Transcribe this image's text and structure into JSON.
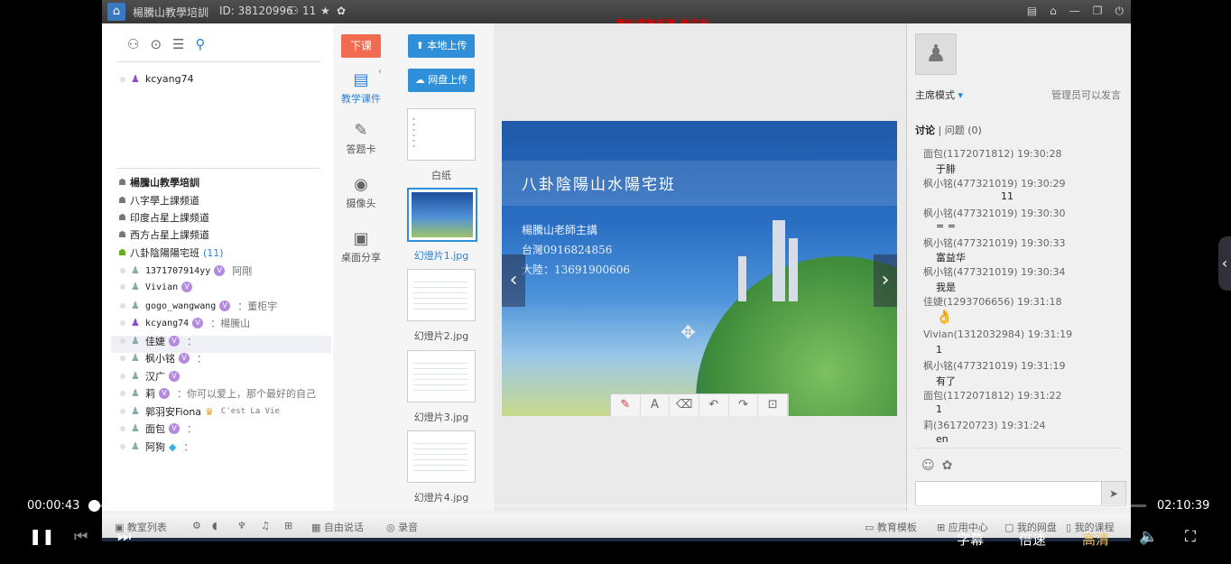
{
  "window": {
    "title": "楊騰山教學培訓",
    "id_text": "ID: 38120996",
    "user_count": "11",
    "notice": "原创求推专享  半注册"
  },
  "left_panel": {
    "top_user": "kcyang74",
    "channels": [
      {
        "label": "楊騰山教學培訓"
      },
      {
        "label": "八字學上課频道"
      },
      {
        "label": "印度占星上課频道"
      },
      {
        "label": "西方占星上課频道"
      },
      {
        "label": "八卦陰陽陽宅班",
        "count": "(11)"
      }
    ],
    "members": [
      {
        "name": "1371707914yy",
        "note": "阿剛"
      },
      {
        "name": "Vivian",
        "note": ""
      },
      {
        "name": "gogo_wangwang",
        "note": "：董柜宇"
      },
      {
        "name": "kcyang74",
        "note": "：楊騰山"
      },
      {
        "name": "佳婕",
        "note": "："
      },
      {
        "name": "枫小铭",
        "note": "："
      },
      {
        "name": "汉广",
        "note": ""
      },
      {
        "name": "莉",
        "note": "：你可以爱上，那个最好的自己"
      },
      {
        "name": "郭羽安Fiona",
        "note": "C'est La Vie"
      },
      {
        "name": "面包",
        "note": "："
      },
      {
        "name": "阿狗",
        "note": "："
      }
    ]
  },
  "tools": {
    "end_class": "下课",
    "items": [
      {
        "label": "教学课件",
        "icon": "courseware-icon"
      },
      {
        "label": "答题卡",
        "icon": "answer-card-icon"
      },
      {
        "label": "摄像头",
        "icon": "camera-icon"
      },
      {
        "label": "桌面分享",
        "icon": "desktop-share-icon"
      }
    ]
  },
  "thumbs": {
    "upload_local": "本地上传",
    "upload_cloud": "网盘上传",
    "items": [
      "白纸",
      "幻燈片1.jpg",
      "幻燈片2.jpg",
      "幻燈片3.jpg",
      "幻燈片4.jpg"
    ]
  },
  "slide": {
    "title": "八卦陰陽山水陽宅班",
    "line1": "楊騰山老師主講",
    "line2": "台灣0916824856",
    "line3": "大陸：13691900606"
  },
  "right_panel": {
    "mode": "主席模式",
    "admin_note": "管理员可以发言",
    "tab_discuss": "讨论",
    "tab_question": "问题",
    "question_count": "(0)",
    "messages": [
      {
        "who": "面包(1172071812) 19:30:28",
        "text": "于腓"
      },
      {
        "who": "枫小铭(477321019) 19:30:29",
        "text": "11"
      },
      {
        "who": "枫小铭(477321019) 19:30:30",
        "text": "= ="
      },
      {
        "who": "枫小铭(477321019) 19:30:33",
        "text": "富益华"
      },
      {
        "who": "枫小铭(477321019) 19:30:34",
        "text": "我是"
      },
      {
        "who": "佳婕(1293706656) 19:31:18",
        "text": "👌"
      },
      {
        "who": "Vivian(1312032984) 19:31:19",
        "text": "1"
      },
      {
        "who": "枫小铭(477321019) 19:31:19",
        "text": "有了"
      },
      {
        "who": "面包(1172071812) 19:31:22",
        "text": "1"
      },
      {
        "who": "莉(361720723) 19:31:24",
        "text": "en"
      }
    ]
  },
  "statusbar": {
    "classroom_list": "教室列表",
    "free_talk": "自由说话",
    "record": "录音",
    "edu_template": "教育模板",
    "app_center": "应用中心",
    "my_cloud": "我的网盘",
    "my_courses": "我的课程"
  },
  "player": {
    "current_time": "00:00:43",
    "total_time": "02:10:39",
    "progress_fraction": 0.0055,
    "subtitles": "字幕",
    "speed": "倍速",
    "quality": "高清"
  }
}
